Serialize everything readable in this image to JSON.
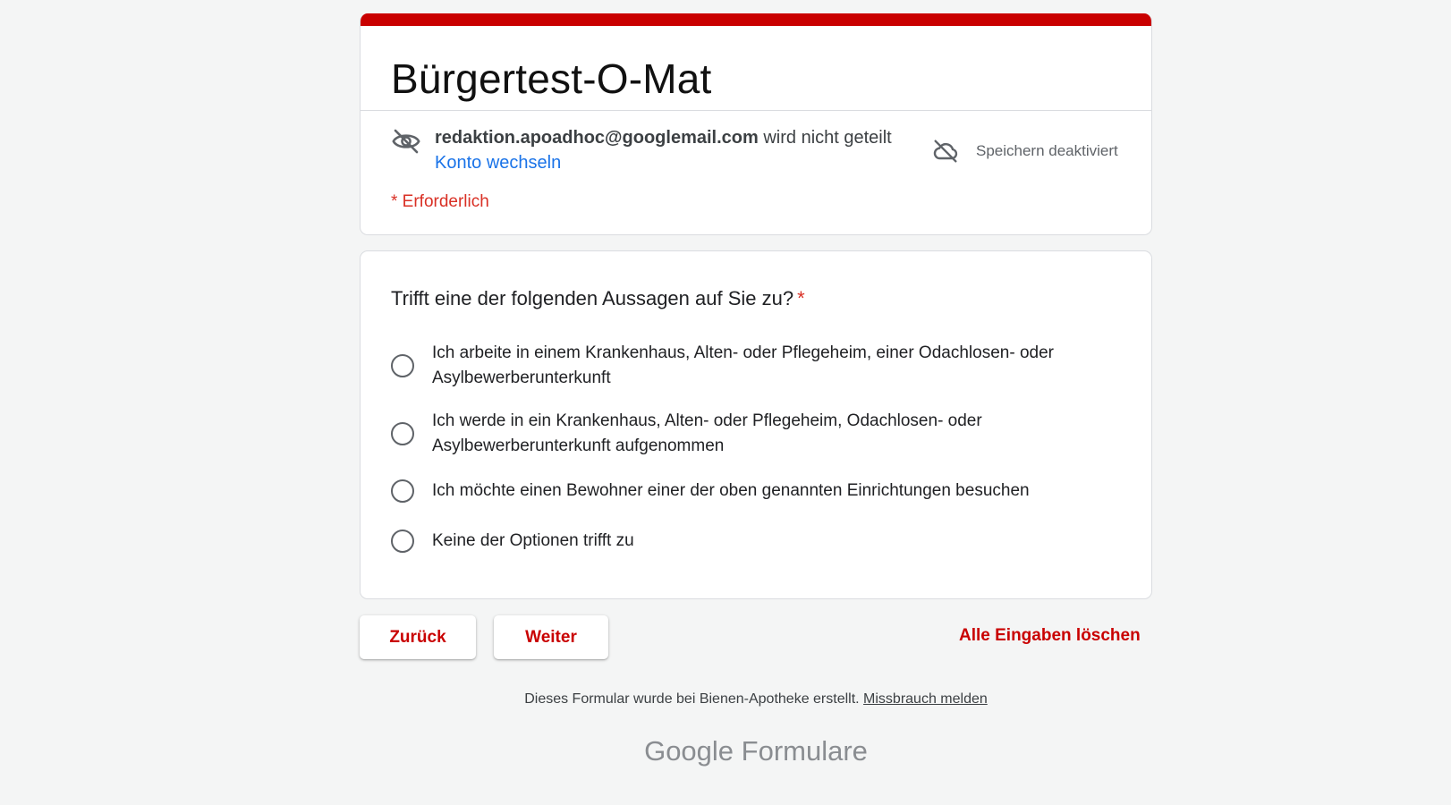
{
  "form": {
    "title": "Bürgertest-O-Mat",
    "accent_color": "#c90000"
  },
  "account": {
    "email": "redaktion.apoadhoc@googlemail.com",
    "not_shared_text": " wird nicht geteilt",
    "switch_account_label": "Konto wechseln",
    "save_status": "Speichern deaktiviert",
    "required_note": "* Erforderlich",
    "icons": [
      "eye-off-icon",
      "cloud-off-icon"
    ]
  },
  "question": {
    "text": "Trifft eine der folgenden Aussagen auf Sie zu?",
    "required_marker": "*",
    "options": [
      {
        "label": "Ich arbeite in einem Krankenhaus, Alten- oder Pflegeheim, einer Odachlosen- oder Asylbewerberunterkunft"
      },
      {
        "label": "Ich werde in ein Krankenhaus, Alten- oder Pflegeheim, Odachlosen- oder Asylbewerberunterkunft aufgenommen"
      },
      {
        "label": "Ich möchte einen Bewohner einer der oben genannten Einrichtungen besuchen"
      },
      {
        "label": "Keine der Optionen trifft zu"
      }
    ]
  },
  "navigation": {
    "back_label": "Zurück",
    "next_label": "Weiter",
    "clear_label": "Alle Eingaben löschen"
  },
  "footer": {
    "note": "Dieses Formular wurde bei Bienen-Apotheke erstellt. ",
    "abuse_link": "Missbrauch melden",
    "brand_google": "Google",
    "brand_product": " Formulare"
  }
}
